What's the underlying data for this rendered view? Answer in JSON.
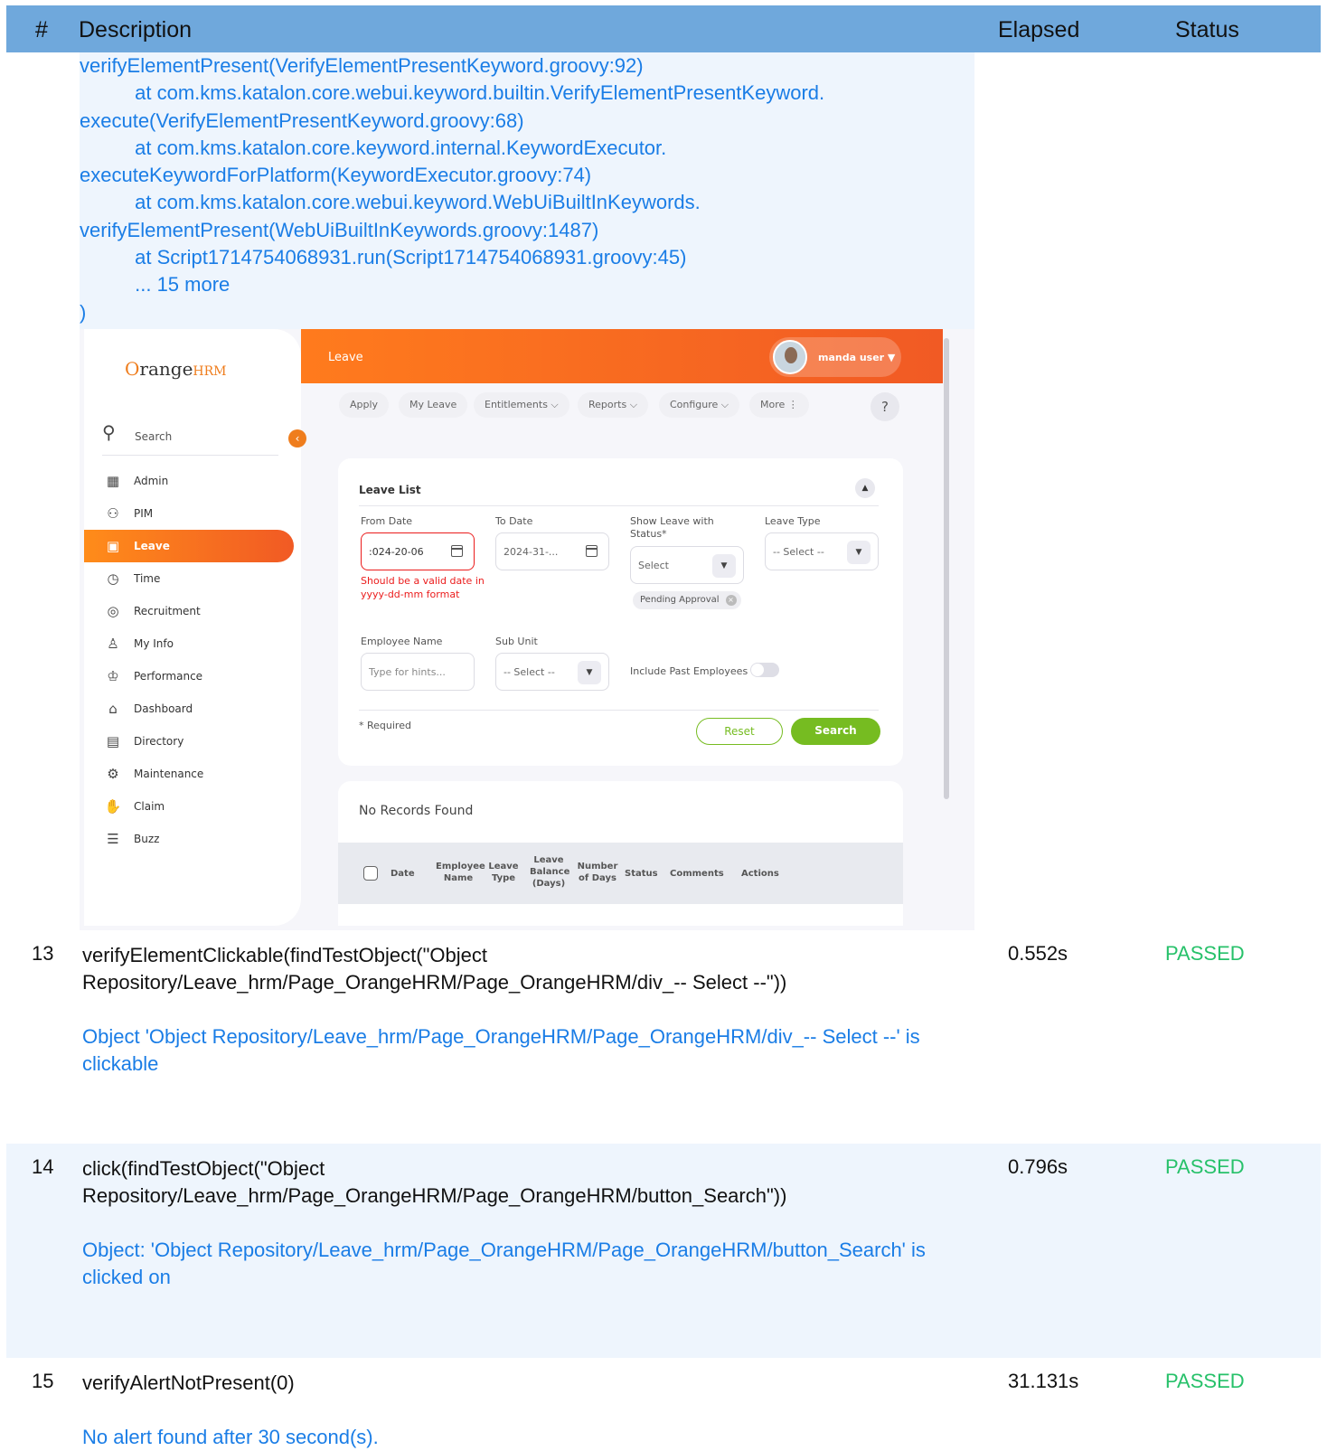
{
  "table_header": {
    "num": "#",
    "description": "Description",
    "elapsed": "Elapsed",
    "status": "Status"
  },
  "trace_lines": [
    "verifyElementPresent(VerifyElementPresentKeyword.groovy:92)",
    "          at com.kms.katalon.core.webui.keyword.builtin.VerifyElementPresentKeyword.",
    "execute(VerifyElementPresentKeyword.groovy:68)",
    "          at com.kms.katalon.core.keyword.internal.KeywordExecutor.",
    "executeKeywordForPlatform(KeywordExecutor.groovy:74)",
    "          at com.kms.katalon.core.webui.keyword.WebUiBuiltInKeywords.",
    "verifyElementPresent(WebUiBuiltInKeywords.groovy:1487)",
    "          at Script1714754068931.run(Script1714754068931.groovy:45)",
    "          ... 15 more",
    ")"
  ],
  "screenshot": {
    "logo": {
      "first": "O",
      "mid": "range",
      "brand": "HRM"
    },
    "sidebar": {
      "search_label": "Search",
      "items": [
        {
          "label": "Admin",
          "icon": "admin-icon"
        },
        {
          "label": "PIM",
          "icon": "pim-icon"
        },
        {
          "label": "Leave",
          "icon": "leave-icon"
        },
        {
          "label": "Time",
          "icon": "time-icon"
        },
        {
          "label": "Recruitment",
          "icon": "recruitment-icon"
        },
        {
          "label": "My Info",
          "icon": "my-info-icon"
        },
        {
          "label": "Performance",
          "icon": "performance-icon"
        },
        {
          "label": "Dashboard",
          "icon": "dashboard-icon"
        },
        {
          "label": "Directory",
          "icon": "directory-icon"
        },
        {
          "label": "Maintenance",
          "icon": "maintenance-icon"
        },
        {
          "label": "Claim",
          "icon": "claim-icon"
        },
        {
          "label": "Buzz",
          "icon": "buzz-icon"
        }
      ],
      "active": "Leave"
    },
    "topbar": {
      "title": "Leave",
      "user_name": "manda user ▼"
    },
    "subnav": {
      "apply": "Apply",
      "my_leave": "My Leave",
      "entitlements": "Entitlements ⌵",
      "reports": "Reports ⌵",
      "configure": "Configure ⌵",
      "more": "More ⋮",
      "help": "?"
    },
    "leave_list": {
      "title": "Leave List",
      "from_date_label": "From Date",
      "from_date_value": ":024-20-06",
      "from_date_error": "Should be a valid date in yyyy-dd-mm format",
      "to_date_label": "To Date",
      "to_date_value": "2024-31-...",
      "status_label": "Show Leave with Status*",
      "status_value": "Select",
      "status_chip": "Pending Approval",
      "leave_type_label": "Leave Type",
      "leave_type_value": "-- Select --",
      "employee_name_label": "Employee Name",
      "employee_name_placeholder": "Type for hints...",
      "sub_unit_label": "Sub Unit",
      "sub_unit_value": "-- Select --",
      "include_past_label": "Include Past Employees",
      "required_note": "* Required",
      "reset_label": "Reset",
      "search_label": "Search"
    },
    "records": {
      "title": "No Records Found",
      "columns": [
        "Date",
        "Employee Name",
        "Leave Type",
        "Leave Balance (Days)",
        "Number of Days",
        "Status",
        "Comments",
        "Actions"
      ]
    }
  },
  "steps": [
    {
      "num": "13",
      "description": "verifyElementClickable(findTestObject(\"Object Repository/Leave_hrm/Page_OrangeHRM/Page_OrangeHRM/div_-- Select --\"))",
      "message": "Object 'Object Repository/Leave_hrm/Page_OrangeHRM/Page_OrangeHRM/div_-- Select --' is clickable",
      "elapsed": "0.552s",
      "status": "PASSED"
    },
    {
      "num": "14",
      "description": "click(findTestObject(\"Object Repository/Leave_hrm/Page_OrangeHRM/Page_OrangeHRM/button_Search\"))",
      "message": "Object: 'Object Repository/Leave_hrm/Page_OrangeHRM/Page_OrangeHRM/button_Search' is clicked on",
      "elapsed": "0.796s",
      "status": "PASSED"
    },
    {
      "num": "15",
      "description": "verifyAlertNotPresent(0)",
      "message": "No alert found after 30 second(s).",
      "elapsed": "31.131s",
      "status": "PASSED"
    }
  ],
  "colors": {
    "header_bg": "#6fa8dc",
    "message_blue": "#1a7de6",
    "passed_green": "#27c16a",
    "orange": "#f15a24",
    "hrm_green": "#76bc21"
  }
}
